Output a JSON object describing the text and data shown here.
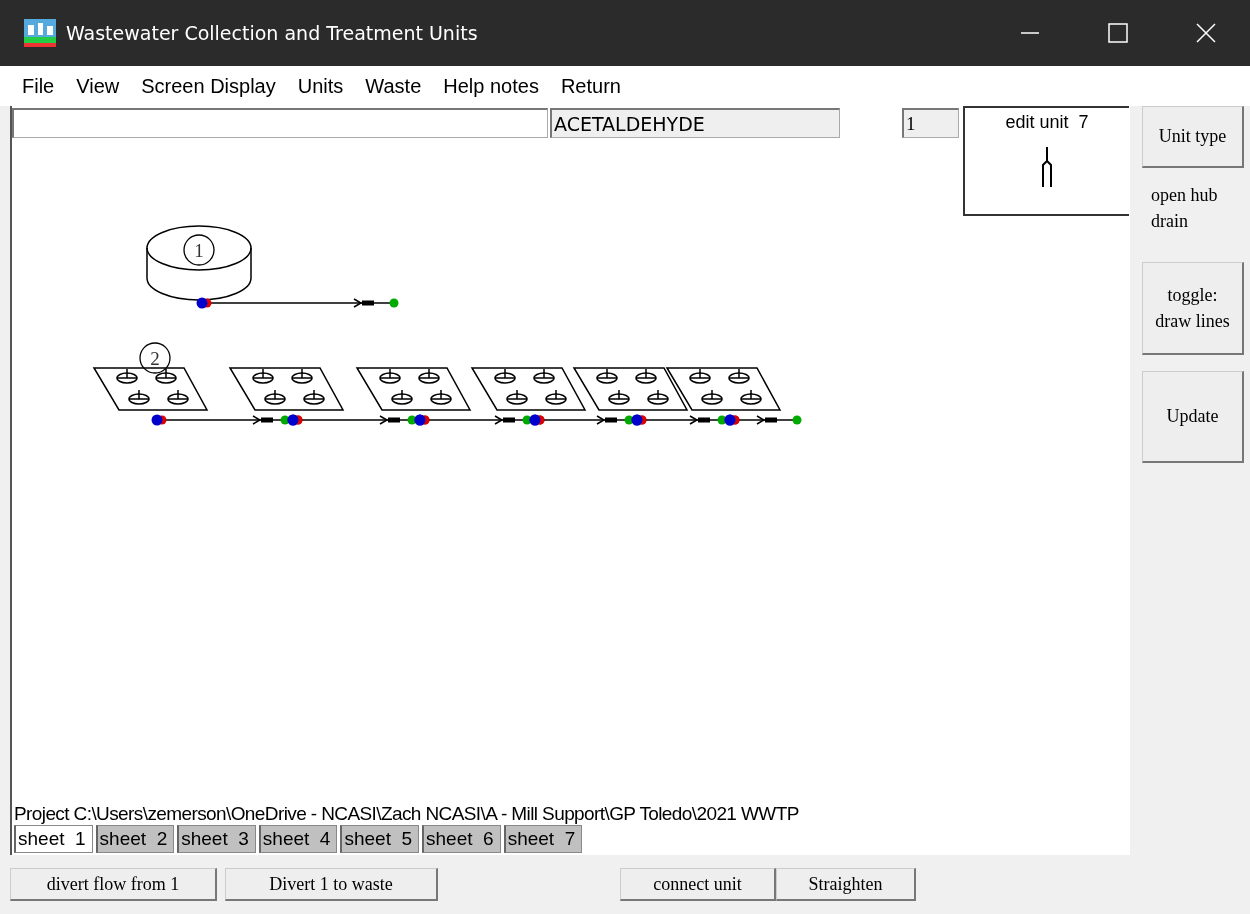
{
  "window": {
    "title": "Wastewater Collection and Treatment Units"
  },
  "menu": [
    "File",
    "View",
    "Screen Display",
    "Units",
    "Waste",
    "Help notes",
    "Return"
  ],
  "compound_field": {
    "value": "ACETALDEHYDE"
  },
  "count_field": {
    "value": "1"
  },
  "edit_unit": {
    "title": "edit unit  7"
  },
  "side_panel": {
    "unit_type_button": "Unit type",
    "unit_type_name": "open hub drain",
    "toggle_button": "toggle: draw lines",
    "update_button": "Update"
  },
  "diagram": {
    "units": [
      {
        "kind": "tank",
        "label": "1"
      },
      {
        "kind": "drain",
        "label": "2"
      },
      {
        "kind": "drain"
      },
      {
        "kind": "drain"
      },
      {
        "kind": "drain"
      },
      {
        "kind": "drain"
      },
      {
        "kind": "drain"
      }
    ]
  },
  "project_path": "Project C:\\Users\\zemerson\\OneDrive - NCASI\\Zach NCASI\\A - Mill Support\\GP Toledo\\2021 WWTP",
  "sheets": [
    {
      "label": "sheet  1",
      "selected": true
    },
    {
      "label": "sheet  2",
      "selected": false
    },
    {
      "label": "sheet  3",
      "selected": false
    },
    {
      "label": "sheet  4",
      "selected": false
    },
    {
      "label": "sheet  5",
      "selected": false
    },
    {
      "label": "sheet  6",
      "selected": false
    },
    {
      "label": "sheet  7",
      "selected": false
    }
  ],
  "flow_buttons": [
    "divert flow from  1",
    "Divert 1 to waste"
  ],
  "connect_buttons": [
    "connect unit",
    "Straighten"
  ]
}
